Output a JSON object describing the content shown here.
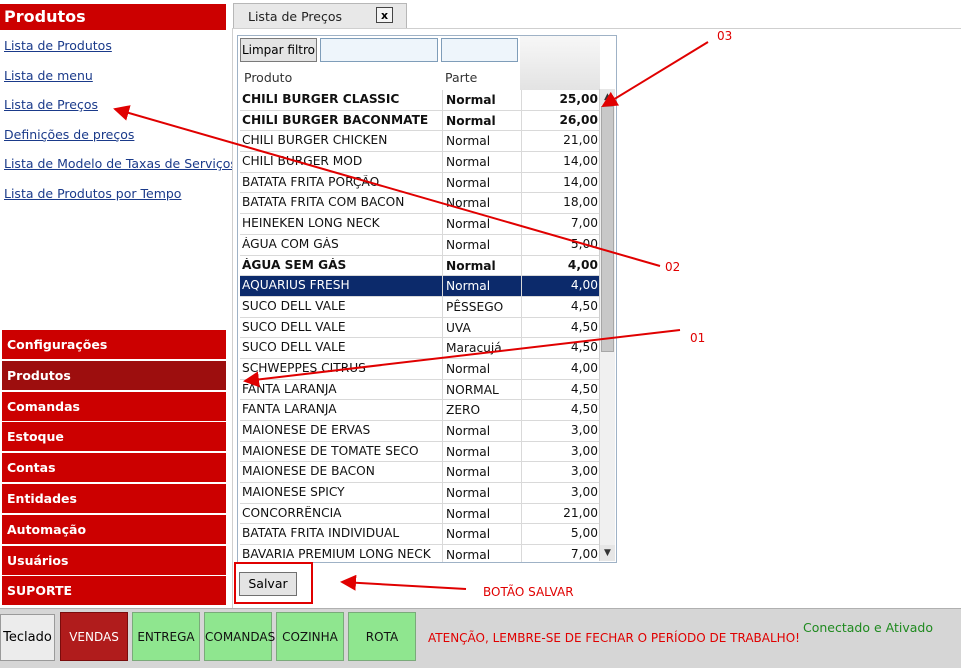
{
  "sidebar": {
    "title": "Produtos",
    "links": [
      "Lista de Produtos",
      "Lista de menu",
      "Lista de Preços",
      "Definições de preços",
      "Lista de Modelo de Taxas de Serviços",
      "Lista de Produtos por Tempo"
    ],
    "modules": [
      {
        "label": "Configurações",
        "active": false
      },
      {
        "label": "Produtos",
        "active": true
      },
      {
        "label": "Comandas",
        "active": false
      },
      {
        "label": "Estoque",
        "active": false
      },
      {
        "label": "Contas",
        "active": false
      },
      {
        "label": "Entidades",
        "active": false
      },
      {
        "label": "Automação",
        "active": false
      },
      {
        "label": "Usuários",
        "active": false
      },
      {
        "label": "SUPORTE",
        "active": false
      }
    ]
  },
  "tab": {
    "label": "Lista de Preços",
    "close": "x"
  },
  "grid": {
    "clear_filter": "Limpar filtro",
    "columns": [
      "Produto",
      "Parte"
    ],
    "rows": [
      {
        "produto": "CHILI BURGER CLASSIC",
        "parte": "Normal",
        "preco": "25,00",
        "bold": true
      },
      {
        "produto": "CHILI BURGER BACONMATE",
        "parte": "Normal",
        "preco": "26,00",
        "bold": true
      },
      {
        "produto": "CHILI BURGER CHICKEN",
        "parte": "Normal",
        "preco": "21,00"
      },
      {
        "produto": "CHILI BURGER MOD",
        "parte": "Normal",
        "preco": "14,00"
      },
      {
        "produto": "BATATA FRITA PORÇÃO",
        "parte": "Normal",
        "preco": "14,00"
      },
      {
        "produto": "BATATA FRITA COM BACON",
        "parte": "Normal",
        "preco": "18,00"
      },
      {
        "produto": "HEINEKEN LONG NECK",
        "parte": "Normal",
        "preco": "7,00"
      },
      {
        "produto": "ÁGUA COM GÁS",
        "parte": "Normal",
        "preco": "5,00"
      },
      {
        "produto": "ÁGUA SEM GÁS",
        "parte": "Normal",
        "preco": "4,00",
        "bold": true
      },
      {
        "produto": "AQUARIUS FRESH",
        "parte": "Normal",
        "preco": "4,00",
        "selected": true
      },
      {
        "produto": "SUCO DELL VALE",
        "parte": "PÊSSEGO",
        "preco": "4,50"
      },
      {
        "produto": "SUCO DELL VALE",
        "parte": "UVA",
        "preco": "4,50"
      },
      {
        "produto": "SUCO DELL VALE",
        "parte": "Maracujá",
        "preco": "4,50"
      },
      {
        "produto": "SCHWEPPES CITRUS",
        "parte": "Normal",
        "preco": "4,00"
      },
      {
        "produto": "FANTA LARANJA",
        "parte": "NORMAL",
        "preco": "4,50"
      },
      {
        "produto": "FANTA LARANJA",
        "parte": "ZERO",
        "preco": "4,50"
      },
      {
        "produto": "MAIONESE DE ERVAS",
        "parte": "Normal",
        "preco": "3,00"
      },
      {
        "produto": "MAIONESE DE TOMATE SECO",
        "parte": "Normal",
        "preco": "3,00"
      },
      {
        "produto": "MAIONESE DE BACON",
        "parte": "Normal",
        "preco": "3,00"
      },
      {
        "produto": "MAIONESE SPICY",
        "parte": "Normal",
        "preco": "3,00"
      },
      {
        "produto": "CONCORRÊNCIA",
        "parte": "Normal",
        "preco": "21,00"
      },
      {
        "produto": "BATATA FRITA INDIVIDUAL",
        "parte": "Normal",
        "preco": "5,00"
      },
      {
        "produto": "BAVARIA PREMIUM LONG NECK",
        "parte": "Normal",
        "preco": "7,00"
      }
    ]
  },
  "save_label": "Salvar",
  "annotations": {
    "a01": "01",
    "a02": "02",
    "a03": "03",
    "save_note": "BOTÃO SALVAR"
  },
  "bottom": {
    "keyboard": "Teclado",
    "nav": [
      "VENDAS",
      "ENTREGA",
      "COMANDAS",
      "COZINHA",
      "ROTA"
    ],
    "warning": "ATENÇÃO, LEMBRE-SE DE FECHAR O PERÍODO DE TRABALHO!",
    "status": "Conectado e Ativado"
  },
  "colors": {
    "brand_red": "#cc0000",
    "active_module": "#9d0e0e",
    "selected_row": "#0c2a6b",
    "nav_green": "#8fe68f",
    "annotation_red": "#e00000",
    "status_green": "#1f8a1f"
  }
}
